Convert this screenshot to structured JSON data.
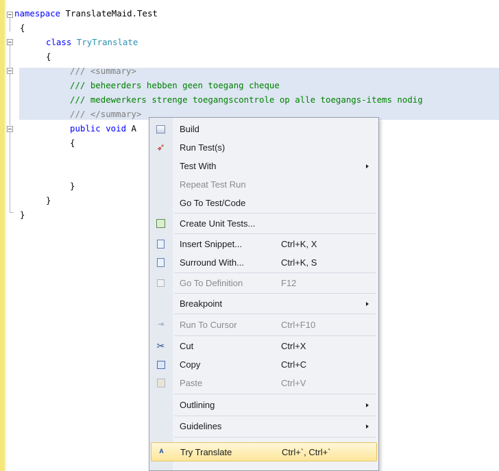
{
  "editor": {
    "lines": [
      {
        "kw": "namespace",
        "rest": " TranslateMaid.Test"
      },
      {
        "text": "{"
      },
      {
        "kw": "class",
        "type": " TryTranslate"
      },
      {
        "text": "{"
      },
      {
        "prefix": "/// ",
        "tag": "<summary>"
      },
      {
        "comment": "/// beheerders hebben geen toegang cheque"
      },
      {
        "comment": "/// medewerkers strenge toegangscontrole op alle toegangs-items nodig"
      },
      {
        "prefix": "/// ",
        "tag": "</summary>"
      },
      {
        "kw1": "public",
        "kw2": " void",
        "rest": " A"
      },
      {
        "text": "{"
      },
      {
        "text": "}"
      },
      {
        "text": "}"
      },
      {
        "text": "}"
      }
    ]
  },
  "context_menu": {
    "items": [
      {
        "label": "Build",
        "icon": "build-icon"
      },
      {
        "label": "Run Test(s)",
        "icon": "rocket-icon"
      },
      {
        "label": "Test With",
        "submenu": true
      },
      {
        "label": "Repeat Test Run",
        "disabled": true
      },
      {
        "label": "Go To Test/Code"
      },
      {
        "label": "Create Unit Tests...",
        "icon": "unit-test-icon"
      },
      {
        "label": "Insert Snippet...",
        "shortcut": "Ctrl+K, X",
        "icon": "snippet-icon"
      },
      {
        "label": "Surround With...",
        "shortcut": "Ctrl+K, S",
        "icon": "surround-icon"
      },
      {
        "label": "Go To Definition",
        "shortcut": "F12",
        "disabled": true,
        "icon": "definition-icon"
      },
      {
        "label": "Breakpoint",
        "submenu": true
      },
      {
        "label": "Run To Cursor",
        "shortcut": "Ctrl+F10",
        "disabled": true,
        "icon": "run-to-cursor-icon"
      },
      {
        "label": "Cut",
        "shortcut": "Ctrl+X",
        "icon": "cut-icon"
      },
      {
        "label": "Copy",
        "shortcut": "Ctrl+C",
        "icon": "copy-icon"
      },
      {
        "label": "Paste",
        "shortcut": "Ctrl+V",
        "disabled": true,
        "icon": "paste-icon"
      },
      {
        "label": "Outlining",
        "submenu": true
      },
      {
        "label": "Guidelines",
        "submenu": true
      },
      {
        "label": "Try Translate",
        "shortcut": "Ctrl+`, Ctrl+`",
        "highlighted": true,
        "icon": "translate-icon"
      }
    ]
  },
  "colors": {
    "keyword": "#0000ff",
    "type": "#2b91af",
    "comment": "#008000",
    "xml_tag": "#808080",
    "selection": "#dde6f2",
    "change_margin": "#f5e77a",
    "menu_highlight": "#fde69a"
  }
}
